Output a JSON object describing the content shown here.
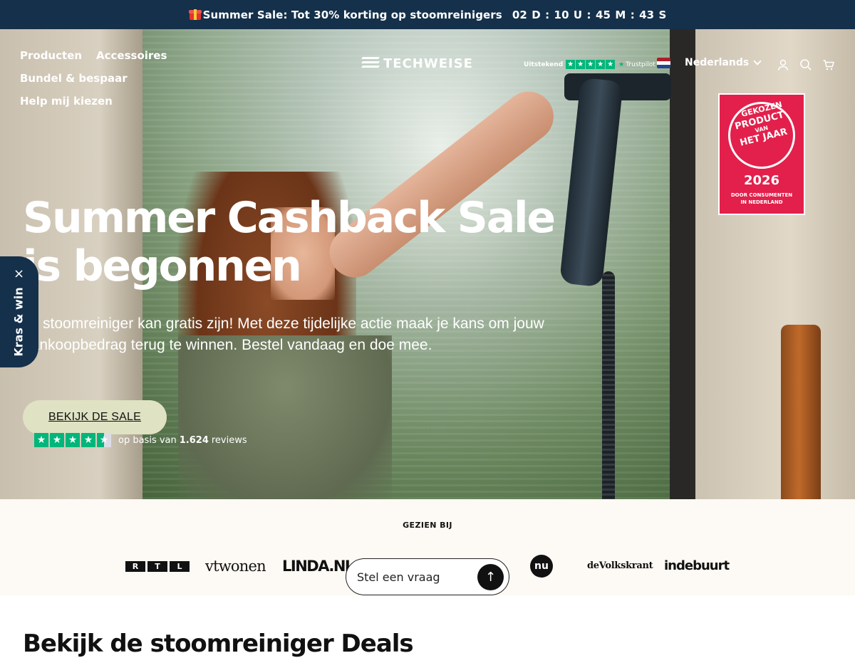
{
  "announcement": {
    "text": "Summer Sale: Tot 30% korting op stoomreinigers",
    "countdown": "02 D : 10 U : 45 M : 43 S",
    "icon": "gift-icon"
  },
  "nav": {
    "items": [
      {
        "label": "Producten"
      },
      {
        "label": "Accessoires"
      },
      {
        "label": "Bundel & bespaar"
      },
      {
        "label": "Help mij kiezen"
      }
    ]
  },
  "logo": {
    "text": "TECHWEISE"
  },
  "trustpilot_badge": {
    "rating_label": "Uitstekend",
    "brand": "Trustpilot"
  },
  "language": {
    "label": "Nederlands",
    "flag_colors": [
      "#ae1c28",
      "#ffffff",
      "#21468b"
    ]
  },
  "header_icons": [
    "account-icon",
    "search-icon",
    "cart-icon"
  ],
  "award": {
    "top": "GEKOZEN",
    "line1": "PRODUCT",
    "line2": "VAN",
    "line3": "HET JAAR",
    "year": "2026",
    "sub_line1": "DOOR CONSUMENTEN",
    "sub_line2": "IN NEDERLAND",
    "color": "#e2204b"
  },
  "hero": {
    "title": "Summer Cashback Sale is begonnen",
    "subtitle": "Je stoomreiniger kan gratis zijn! Met deze tijdelijke actie maak je kans om jouw aankoopbedrag terug te winnen. Bestel vandaag en doe mee.",
    "cta_label": "BEKIJK DE SALE",
    "reviews_prefix": "op basis van",
    "reviews_count": "1.624",
    "reviews_suffix": "reviews",
    "rating_stars": 4.5
  },
  "kras_win": {
    "label": "Kras & win",
    "close": "×"
  },
  "seen_at": {
    "title": "GEZIEN BIJ",
    "brands": {
      "rtl": [
        "R",
        "T",
        "L"
      ],
      "vtwonen": "vtwonen",
      "linda": "LINDA.NL",
      "nu": "nu",
      "volkskrant": "deVolkskrant",
      "indebuurt": "indebuurt"
    }
  },
  "ask": {
    "placeholder": "Stel een vraag",
    "send_icon": "arrow-up-icon"
  },
  "section": {
    "heading": "Bekijk de stoomreiniger Deals"
  },
  "colors": {
    "navy": "#15304a",
    "cta": "#dfe2c3",
    "trustpilot_green": "#00b67a",
    "seen_bg": "#fdf9f4"
  }
}
